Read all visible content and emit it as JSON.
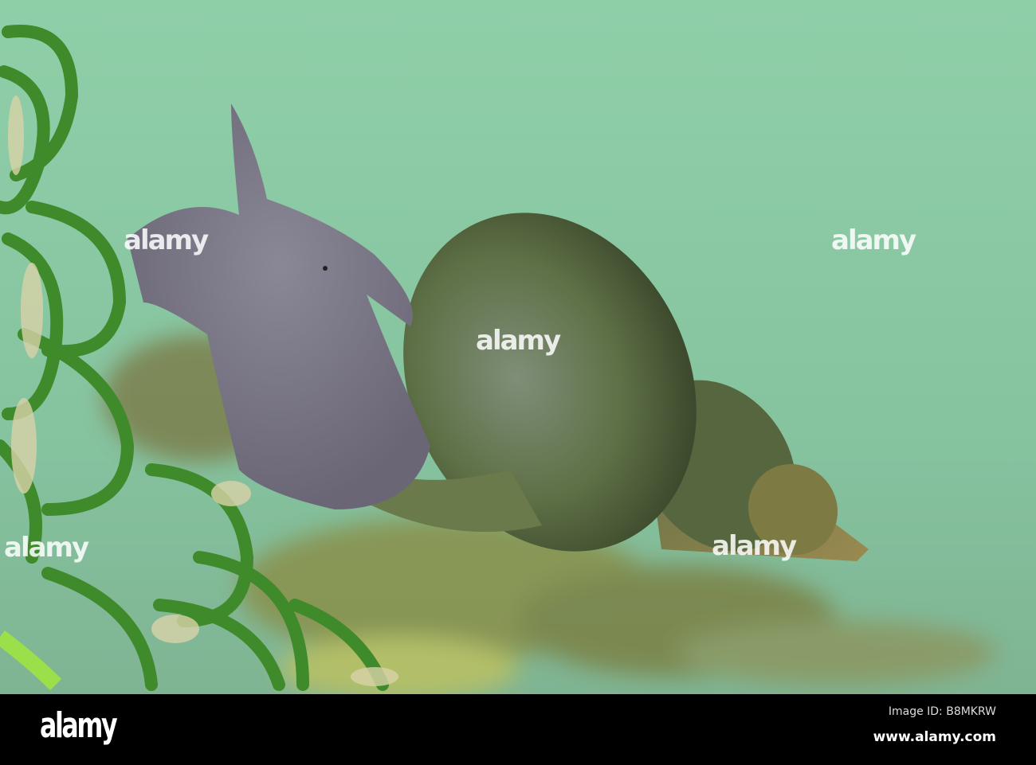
{
  "photo": {
    "subject": "pond snail on aquatic plant"
  },
  "watermark": {
    "text": "alamy"
  },
  "footer": {
    "logo": "alamy",
    "image_id": "Image ID: B8MKRW",
    "url": "www.alamy.com"
  },
  "colors": {
    "water": "#8ccaa4",
    "shell": "#5e7046",
    "body": "#7d7a88",
    "plant": "#3f8a2a"
  }
}
